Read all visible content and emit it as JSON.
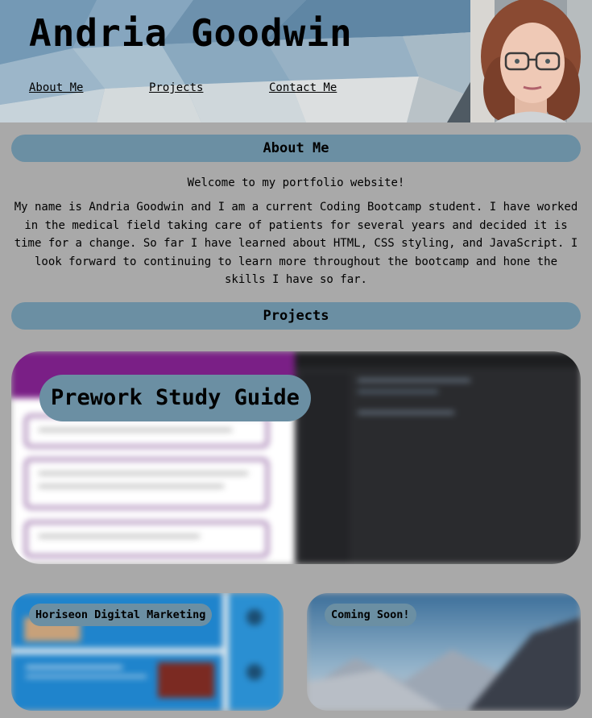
{
  "header": {
    "title": "Andria Goodwin",
    "nav": [
      "About Me",
      "Projects",
      "Contact Me"
    ]
  },
  "about": {
    "heading": "About Me",
    "welcome": "Welcome to my portfolio website!",
    "text": "My name is Andria Goodwin and I am a current Coding Bootcamp student. I have worked in the medical field taking care of patients for several years and decided it is time for a change. So far I have learned about HTML, CSS styling, and JavaScript. I look forward to continuing to learn more throughout the bootcamp and hone the skills I have so far."
  },
  "projects": {
    "heading": "Projects",
    "items": [
      {
        "label": "Prework Study Guide"
      },
      {
        "label": "Horiseon Digital Marketing"
      },
      {
        "label": "Coming Soon!"
      }
    ]
  },
  "colors": {
    "page_bg": "#a9a9a9",
    "accent": "#6b8fa3"
  }
}
